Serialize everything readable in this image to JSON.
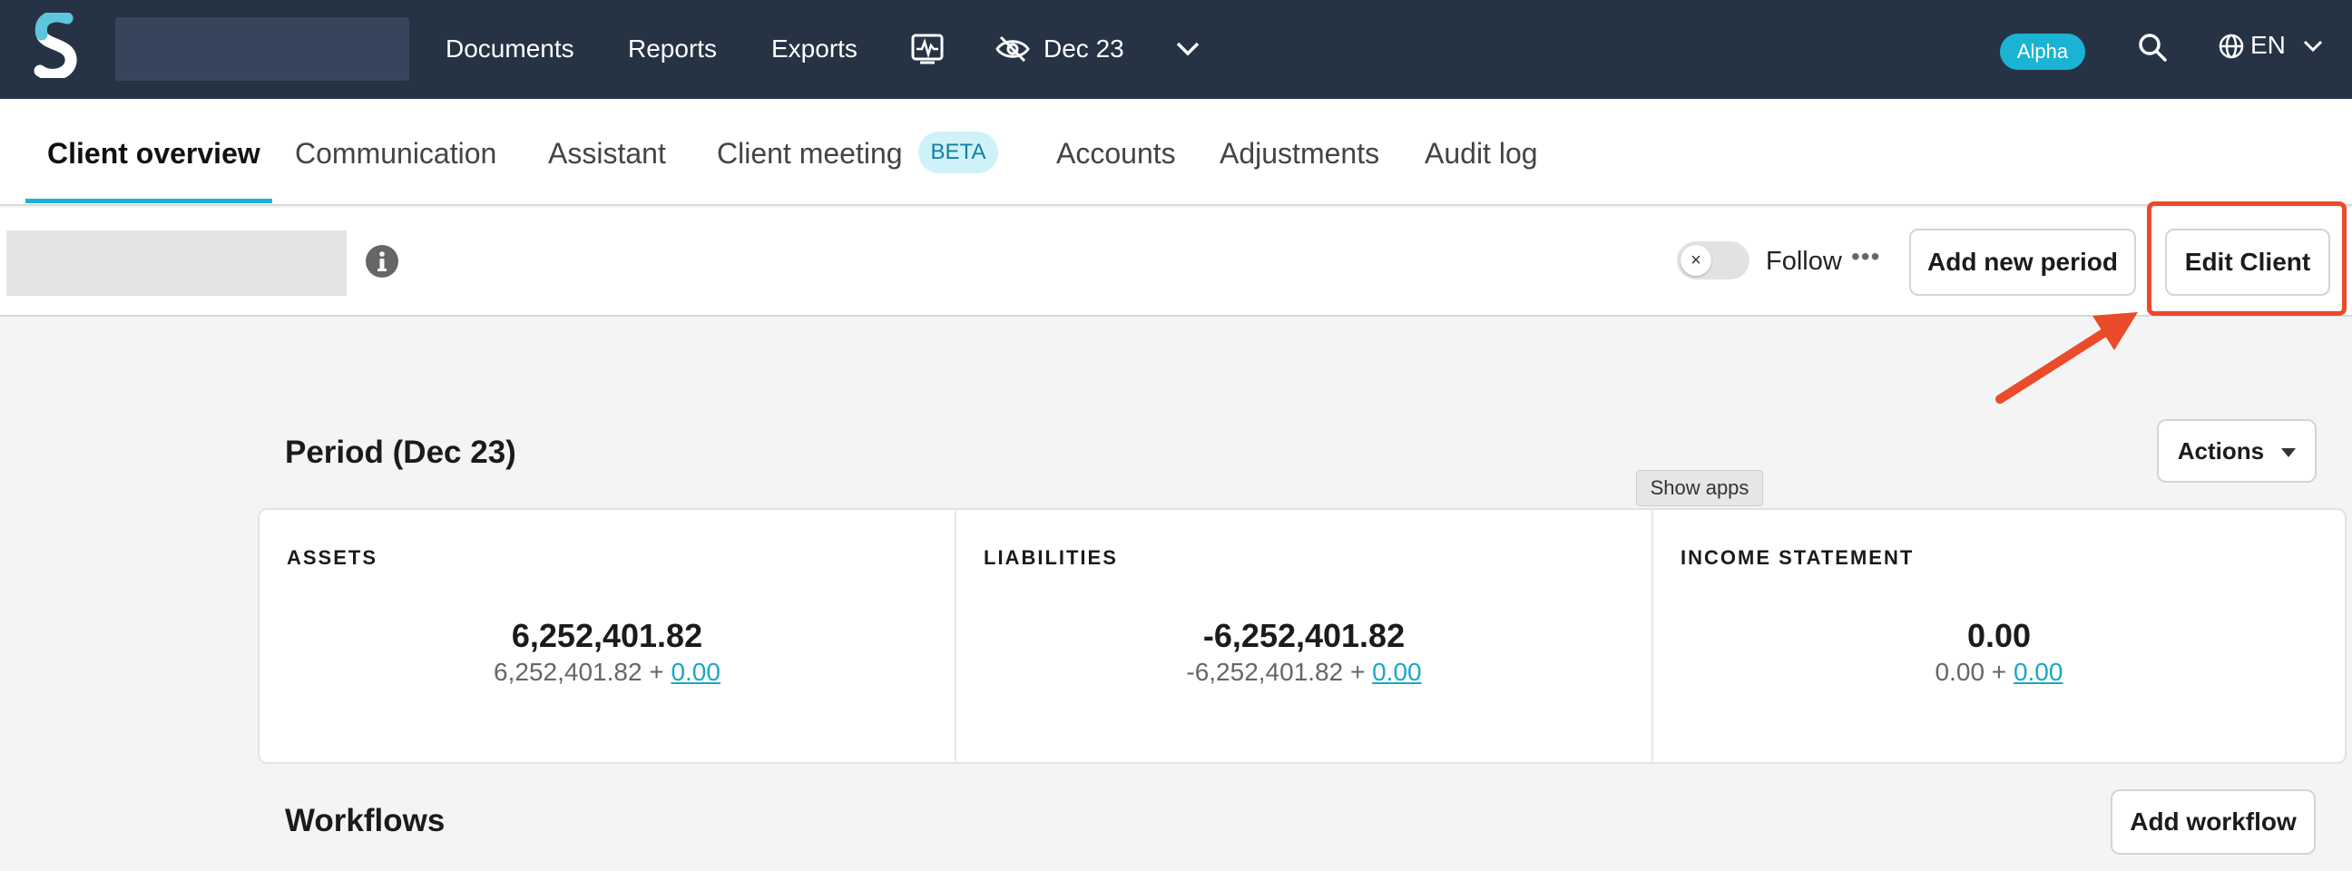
{
  "nav": {
    "documents": "Documents",
    "reports": "Reports",
    "exports": "Exports",
    "period": "Dec 23",
    "alpha": "Alpha",
    "language": "EN",
    "icons": [
      "logo",
      "activity-icon",
      "eye-off-icon",
      "chevron-down-icon",
      "search-icon",
      "globe-icon"
    ]
  },
  "tabs": {
    "client_overview": "Client overview",
    "communication": "Communication",
    "assistant": "Assistant",
    "client_meeting": "Client meeting",
    "beta": "BETA",
    "accounts": "Accounts",
    "adjustments": "Adjustments",
    "audit_log": "Audit log"
  },
  "client": {
    "follow": "Follow",
    "add_period": "Add new period",
    "edit_client": "Edit Client"
  },
  "period": {
    "title": "Period (Dec 23)",
    "actions": "Actions",
    "tooltip": "Show apps",
    "columns": [
      {
        "title": "ASSETS",
        "total": "6,252,401.82",
        "base": "6,252,401.82 +",
        "adjust": "0.00"
      },
      {
        "title": "LIABILITIES",
        "total": "-6,252,401.82",
        "base": "-6,252,401.82 +",
        "adjust": "0.00"
      },
      {
        "title": "INCOME STATEMENT",
        "total": "0.00",
        "base": "0.00 +",
        "adjust": "0.00"
      }
    ]
  },
  "workflows": {
    "title": "Workflows",
    "add": "Add workflow"
  },
  "colors": {
    "nav_bg": "#263345",
    "accent": "#1ab3d4",
    "highlight": "#ea4b2a"
  }
}
